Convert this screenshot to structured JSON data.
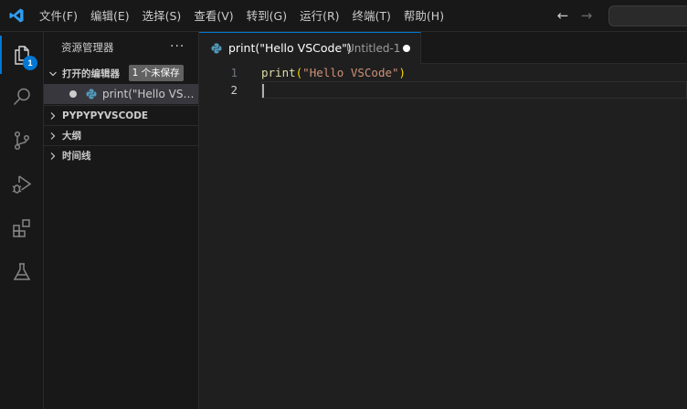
{
  "menu": [
    "文件(F)",
    "编辑(E)",
    "选择(S)",
    "查看(V)",
    "转到(G)",
    "运行(R)",
    "终端(T)",
    "帮助(H)"
  ],
  "activity": {
    "explorer_badge": "1"
  },
  "sidebar": {
    "title": "资源管理器",
    "more": "···",
    "open_editors": {
      "label": "打开的编辑器",
      "badge": "1 个未保存",
      "file": "print(\"Hello VSCode\")"
    },
    "sections": [
      "PYPYPYVSCODE",
      "大纲",
      "时间线"
    ]
  },
  "tab": {
    "name": "print(\"Hello VSCode\")",
    "description": "Untitled-1"
  },
  "editor": {
    "line_numbers": [
      "1",
      "2"
    ],
    "line1": {
      "fn": "print",
      "open": "(",
      "str": "\"Hello VSCode\"",
      "close": ")"
    }
  },
  "colors": {
    "accent": "#0078d4",
    "background": "#1f1f1f",
    "sidebar": "#181818"
  }
}
